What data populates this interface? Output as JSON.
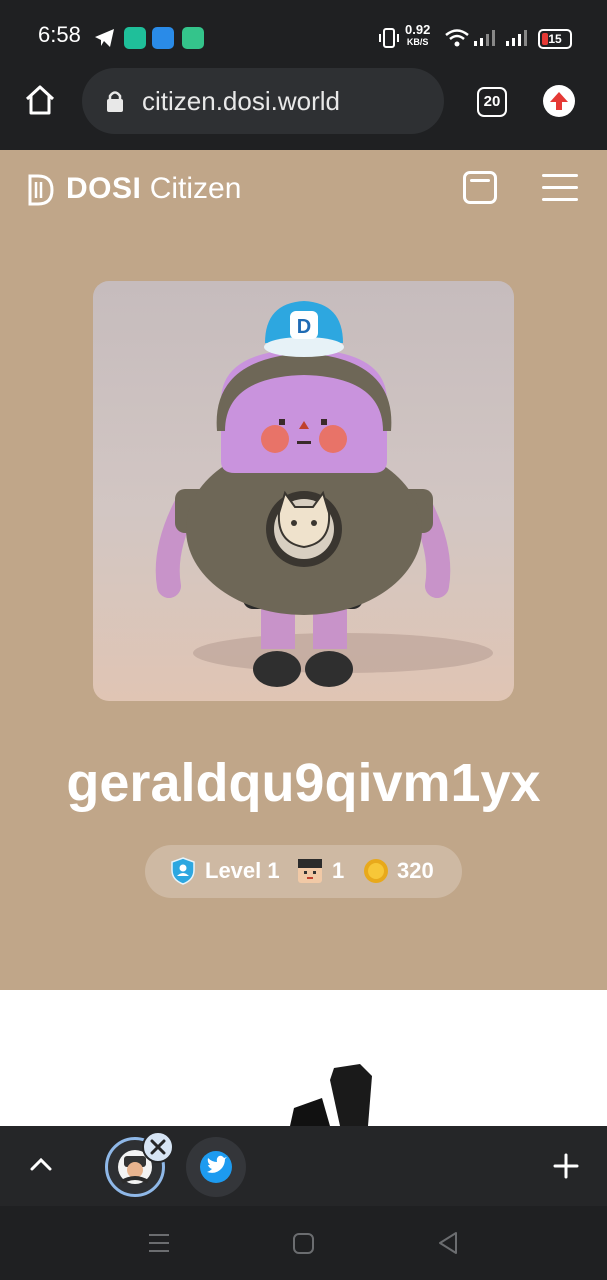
{
  "status_bar": {
    "time": "6:58",
    "net_speed_value": "0.92",
    "net_speed_unit": "KB/S",
    "battery": "15",
    "icons": [
      "telegram-icon",
      "app-icon",
      "app-icon",
      "app-icon",
      "vibrate-icon",
      "wifi-icon",
      "signal-icon",
      "signal-icon",
      "battery-icon"
    ]
  },
  "browser": {
    "url": "citizen.dosi.world",
    "tab_count": "20",
    "icons": [
      "home-icon",
      "lock-icon",
      "tabs-icon",
      "update-icon"
    ]
  },
  "header": {
    "brand_bold": "DOSI",
    "brand_light": "Citizen",
    "icons": [
      "dosi-logo-icon",
      "wallet-icon",
      "menu-icon"
    ]
  },
  "profile": {
    "username": "geraldqu9qivm1yx",
    "level_label": "Level 1",
    "citizen_count": "1",
    "points": "320",
    "avatar_badge_letter": "D"
  },
  "tabstrip": {
    "icons": [
      "chevron-up-icon",
      "avatar-tab-icon",
      "close-icon",
      "twitter-icon",
      "plus-icon"
    ]
  },
  "nav": {
    "icons": [
      "recents-icon",
      "home-nav-icon",
      "back-icon"
    ]
  },
  "colors": {
    "page_bg": "#c0a689",
    "chrome_bg": "#1f2022",
    "accent_blue": "#2da7e0",
    "twitter_blue": "#1d9bf0"
  }
}
